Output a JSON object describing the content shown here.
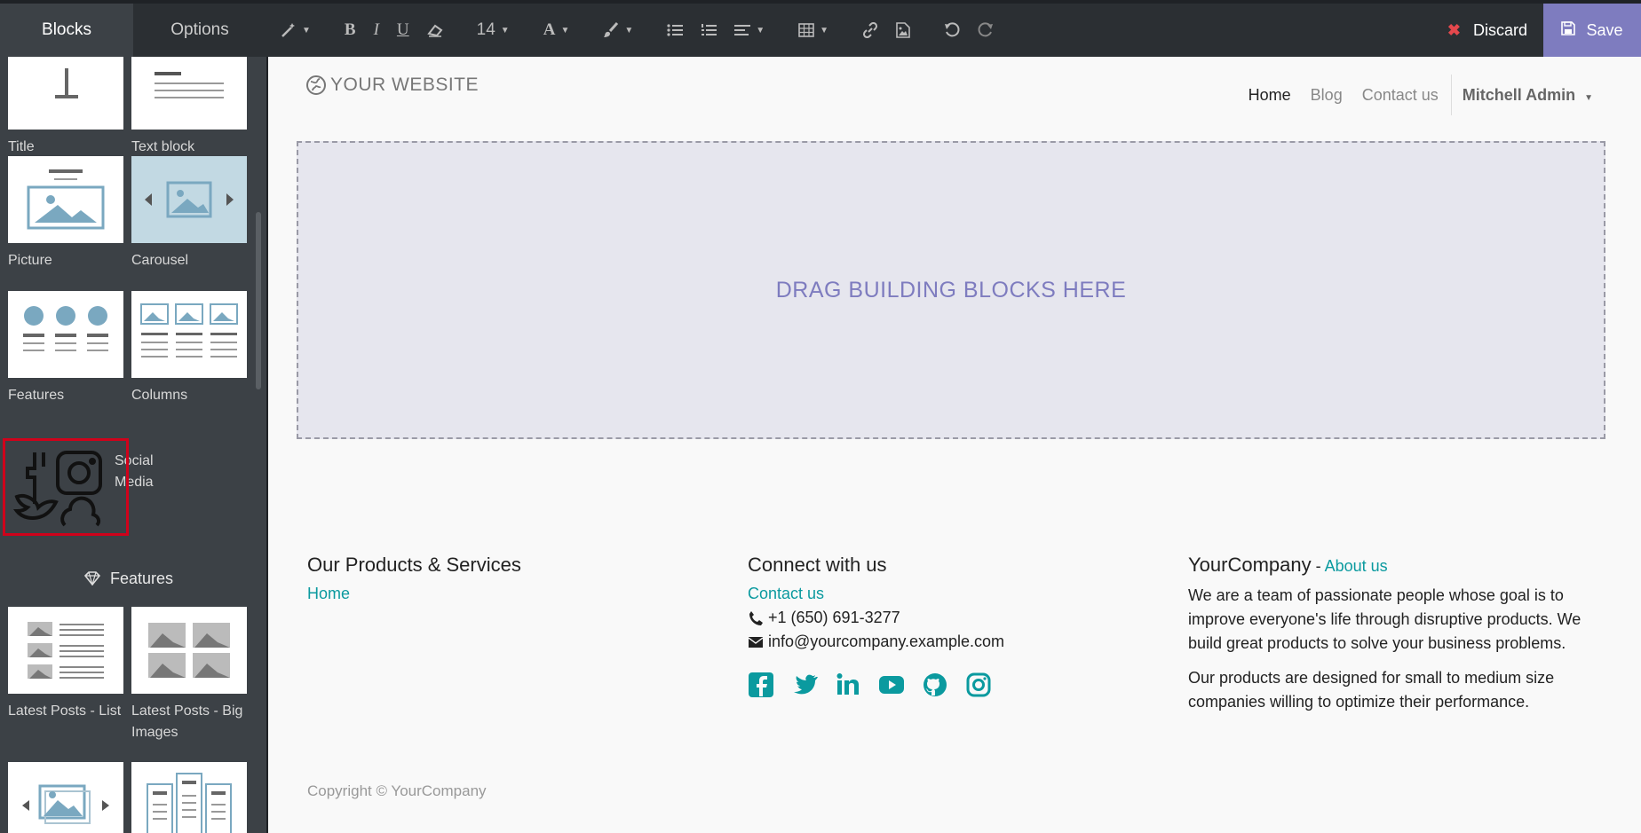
{
  "sidebar": {
    "tabs": [
      {
        "label": "Blocks"
      },
      {
        "label": "Options"
      }
    ],
    "snippets": [
      {
        "label": "Title"
      },
      {
        "label": "Text block"
      },
      {
        "label": "Picture"
      },
      {
        "label": "Carousel"
      },
      {
        "label": "Features"
      },
      {
        "label": "Columns"
      },
      {
        "label": "Social Media"
      },
      {
        "label": "Latest Posts - List"
      },
      {
        "label": "Latest Posts - Big Images"
      }
    ],
    "section_heading": "Features",
    "section_icon": "diamond-icon"
  },
  "toolbar": {
    "font_size": "14",
    "discard_label": "Discard",
    "save_label": "Save"
  },
  "website": {
    "logo_text": "YOUR WEBSITE",
    "nav": [
      {
        "label": "Home"
      },
      {
        "label": "Blog"
      },
      {
        "label": "Contact us"
      }
    ],
    "user": "Mitchell Admin",
    "dropzone_text": "DRAG BUILDING BLOCKS HERE",
    "footer": {
      "col1_title": "Our Products & Services",
      "col1_link": "Home",
      "col2_title": "Connect with us",
      "col2_link": "Contact us",
      "phone": "+1 (650) 691-3277",
      "email": "info@yourcompany.example.com",
      "col3_title": "YourCompany",
      "col3_sep": " - ",
      "col3_link": "About us",
      "para1": "We are a team of passionate people whose goal is to improve everyone's life through disruptive products. We build great products to solve your business problems.",
      "para2": "Our products are designed for small to medium size companies willing to optimize their performance.",
      "copyright": "Copyright © YourCompany"
    },
    "social_icons": [
      "facebook-icon",
      "twitter-icon",
      "linkedin-icon",
      "youtube-icon",
      "github-icon",
      "instagram-icon"
    ]
  },
  "colors": {
    "accent": "#0b9a9f",
    "save": "#7e7cbf",
    "selected_outline": "#d0021b"
  }
}
